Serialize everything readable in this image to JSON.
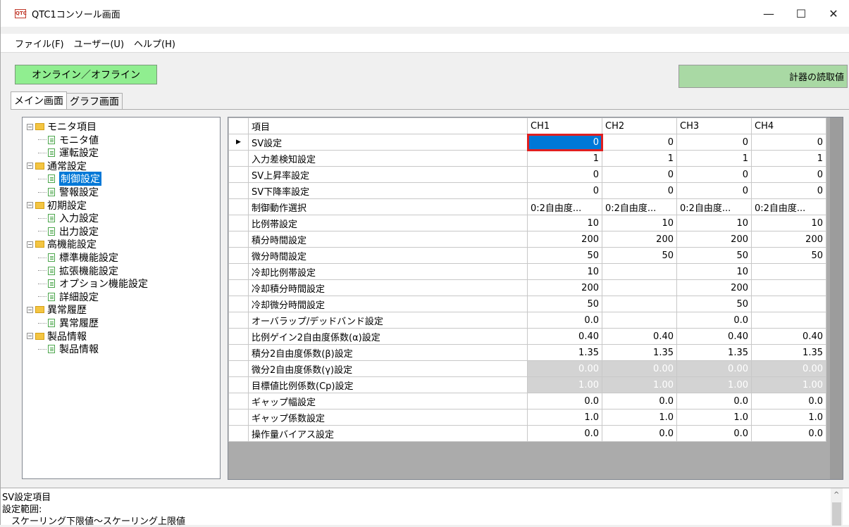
{
  "window": {
    "title": "QTC1コンソール画面",
    "icon_text": "QTC",
    "controls": {
      "minimize": "—",
      "maximize": "☐",
      "close": "✕"
    }
  },
  "menu": [
    "ファイル(F)",
    "ユーザー(U)",
    "ヘルプ(H)"
  ],
  "toolbar": {
    "online_label": "オンライン／オフライン",
    "readout_label": "計器の読取値"
  },
  "tabs": [
    "メイン画面",
    "グラフ画面"
  ],
  "tree": [
    {
      "label": "モニタ項目",
      "type": "folder",
      "level": 0
    },
    {
      "label": "モニタ値",
      "type": "leaf",
      "level": 1
    },
    {
      "label": "運転設定",
      "type": "leaf",
      "level": 1
    },
    {
      "label": "通常設定",
      "type": "folder",
      "level": 0
    },
    {
      "label": "制御設定",
      "type": "leaf",
      "level": 1,
      "selected": true
    },
    {
      "label": "警報設定",
      "type": "leaf",
      "level": 1
    },
    {
      "label": "初期設定",
      "type": "folder",
      "level": 0
    },
    {
      "label": "入力設定",
      "type": "leaf",
      "level": 1
    },
    {
      "label": "出力設定",
      "type": "leaf",
      "level": 1
    },
    {
      "label": "高機能設定",
      "type": "folder",
      "level": 0
    },
    {
      "label": "標準機能設定",
      "type": "leaf",
      "level": 1
    },
    {
      "label": "拡張機能設定",
      "type": "leaf",
      "level": 1
    },
    {
      "label": "オプション機能設定",
      "type": "leaf",
      "level": 1
    },
    {
      "label": "詳細設定",
      "type": "leaf",
      "level": 1
    },
    {
      "label": "異常履歴",
      "type": "folder",
      "level": 0
    },
    {
      "label": "異常履歴",
      "type": "leaf",
      "level": 1
    },
    {
      "label": "製品情報",
      "type": "folder",
      "level": 0
    },
    {
      "label": "製品情報",
      "type": "leaf",
      "level": 1
    }
  ],
  "grid": {
    "headers": [
      "項目",
      "CH1",
      "CH2",
      "CH3",
      "CH4"
    ],
    "current_row_marker": "▶",
    "rows": [
      {
        "item": "SV設定",
        "values": [
          "0",
          "0",
          "0",
          "0"
        ],
        "selected_col": 0
      },
      {
        "item": "入力差検知設定",
        "values": [
          "1",
          "1",
          "1",
          "1"
        ]
      },
      {
        "item": "SV上昇率設定",
        "values": [
          "0",
          "0",
          "0",
          "0"
        ]
      },
      {
        "item": "SV下降率設定",
        "values": [
          "0",
          "0",
          "0",
          "0"
        ]
      },
      {
        "item": "制御動作選択",
        "values": [
          "0:2自由度...",
          "0:2自由度...",
          "0:2自由度...",
          "0:2自由度..."
        ],
        "text": true
      },
      {
        "item": "比例帯設定",
        "values": [
          "10",
          "10",
          "10",
          "10"
        ]
      },
      {
        "item": "積分時間設定",
        "values": [
          "200",
          "200",
          "200",
          "200"
        ]
      },
      {
        "item": "微分時間設定",
        "values": [
          "50",
          "50",
          "50",
          "50"
        ]
      },
      {
        "item": "冷却比例帯設定",
        "values": [
          "10",
          "",
          "10",
          ""
        ]
      },
      {
        "item": "冷却積分時間設定",
        "values": [
          "200",
          "",
          "200",
          ""
        ]
      },
      {
        "item": "冷却微分時間設定",
        "values": [
          "50",
          "",
          "50",
          ""
        ]
      },
      {
        "item": "オーバラップ/デッドバンド設定",
        "values": [
          "0.0",
          "",
          "0.0",
          ""
        ]
      },
      {
        "item": "比例ゲイン2自由度係数(α)設定",
        "values": [
          "0.40",
          "0.40",
          "0.40",
          "0.40"
        ]
      },
      {
        "item": "積分2自由度係数(β)設定",
        "values": [
          "1.35",
          "1.35",
          "1.35",
          "1.35"
        ]
      },
      {
        "item": "微分2自由度係数(γ)設定",
        "values": [
          "0.00",
          "0.00",
          "0.00",
          "0.00"
        ],
        "disabled": true
      },
      {
        "item": "目標値比例係数(Cp)設定",
        "values": [
          "1.00",
          "1.00",
          "1.00",
          "1.00"
        ],
        "disabled": true
      },
      {
        "item": "ギャップ幅設定",
        "values": [
          "0.0",
          "0.0",
          "0.0",
          "0.0"
        ]
      },
      {
        "item": "ギャップ係数設定",
        "values": [
          "1.0",
          "1.0",
          "1.0",
          "1.0"
        ]
      },
      {
        "item": "操作量バイアス設定",
        "values": [
          "0.0",
          "0.0",
          "0.0",
          "0.0"
        ]
      }
    ]
  },
  "description": {
    "lines": [
      "SV設定項目",
      "設定範囲:",
      "　スケーリング下限値〜スケーリング上限値"
    ],
    "scroll_up": "^"
  }
}
